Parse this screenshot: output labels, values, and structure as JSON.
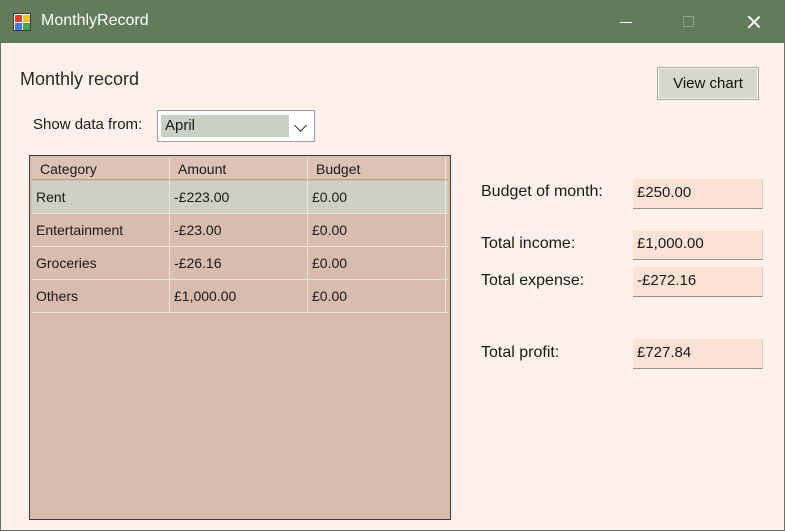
{
  "window": {
    "title": "MonthlyRecord",
    "icon": "app-icon",
    "controls": [
      "minimize-icon",
      "maximize-icon",
      "close-icon"
    ]
  },
  "main": {
    "heading": "Monthly record",
    "view_chart_label": "View chart",
    "filter": {
      "label": "Show data from:",
      "selected": "April"
    }
  },
  "table": {
    "columns": [
      "Category",
      "Amount",
      "Budget"
    ],
    "rows": [
      {
        "category": "Rent",
        "amount": "-£223.00",
        "budget": "£0.00"
      },
      {
        "category": "Entertainment",
        "amount": "-£23.00",
        "budget": "£0.00"
      },
      {
        "category": "Groceries",
        "amount": "-£26.16",
        "budget": "£0.00"
      },
      {
        "category": "Others",
        "amount": "£1,000.00",
        "budget": "£0.00"
      }
    ]
  },
  "summary": {
    "budget_label": "Budget of month:",
    "budget_value": "£250.00",
    "income_label": "Total income:",
    "income_value": "£1,000.00",
    "expense_label": "Total expense:",
    "expense_value": "-£272.16",
    "profit_label": "Total profit:",
    "profit_value": "£727.84"
  },
  "colors": {
    "titlebar": "#627b5a",
    "background": "#fdf1ea",
    "grid": "#d8bcad",
    "selected_row": "#ccd1c3",
    "input_box": "#fde3d6"
  }
}
